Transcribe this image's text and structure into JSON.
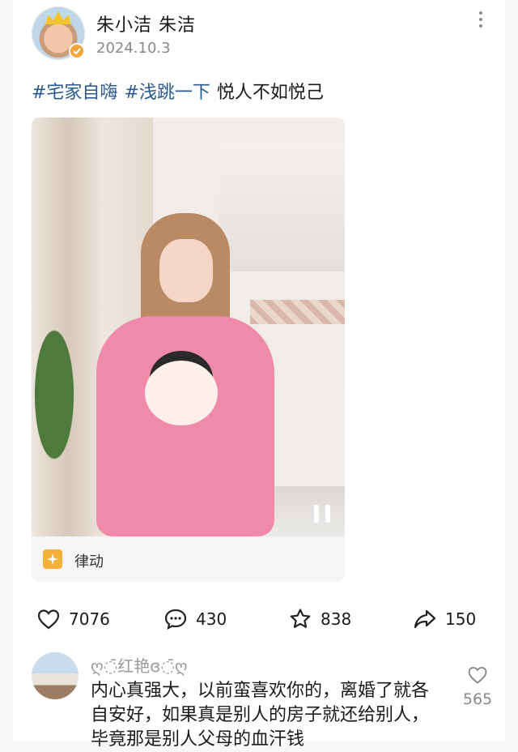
{
  "post": {
    "author": "朱小洁  朱洁",
    "date": "2024.10.3",
    "tags": [
      "#宅家自嗨",
      "#浅跳一下"
    ],
    "text": "悦人不如悦己"
  },
  "video": {
    "music_label": "律动"
  },
  "actions": {
    "likes": "7076",
    "comments": "430",
    "favorites": "838",
    "shares": "150"
  },
  "comment": {
    "username": "ღ◌̄红艳ɞ◌̄ღ",
    "text": "内心真强大，以前蛮喜欢你的，离婚了就各自安好，如果真是别人的房子就还给别人，毕竟那是别人父母的血汗钱",
    "likes": "565"
  },
  "colors": {
    "tag": "#2a5a8f",
    "verified": "#f3a43b",
    "music_icon": "#f3b13b"
  }
}
